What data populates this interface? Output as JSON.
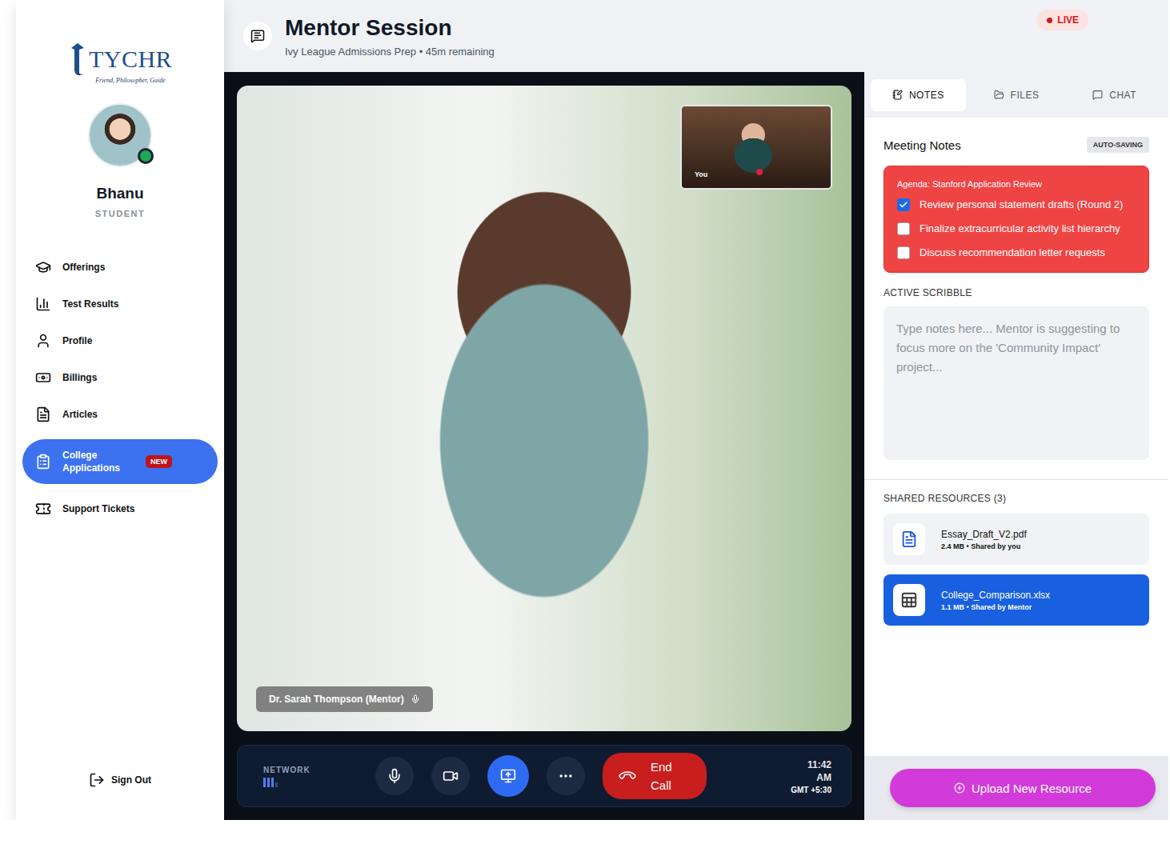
{
  "header": {
    "title": "Mentor Session",
    "subtitle": "Ivy League Admissions Prep • 45m remaining",
    "live_badge": "LIVE"
  },
  "sidebar": {
    "logo": "TYCHR",
    "tagline": "Friend, Philosopher, Guide",
    "user": {
      "name": "Bhanu",
      "role": "STUDENT",
      "online": true
    },
    "items": [
      {
        "label": "Offerings",
        "selected": false,
        "badge": ""
      },
      {
        "label": "Test Results",
        "selected": false,
        "badge": ""
      },
      {
        "label": "Profile",
        "selected": false,
        "badge": ""
      },
      {
        "label": "Billings",
        "selected": false,
        "badge": ""
      },
      {
        "label": "Articles",
        "selected": false,
        "badge": ""
      },
      {
        "label": "College Applications",
        "selected": true,
        "badge": "NEW"
      },
      {
        "label": "Support Tickets",
        "selected": false,
        "badge": ""
      }
    ],
    "sign_out": "Sign Out"
  },
  "video": {
    "mentor_label": "Dr. Sarah Thompson (Mentor)",
    "mentor_mic_on": true,
    "self_label": "You",
    "self_muted": true
  },
  "controls": {
    "network_label": "NETWORK",
    "network_level": 0.75,
    "buttons": [
      {
        "kind": "mic",
        "active": false
      },
      {
        "kind": "camera",
        "active": false
      },
      {
        "kind": "share",
        "active": true
      },
      {
        "kind": "more",
        "active": false
      }
    ],
    "end_call": "End Call",
    "time": "11:42 AM",
    "timezone": "GMT +5:30"
  },
  "panel": {
    "tabs": [
      {
        "label": "NOTES",
        "selected": true
      },
      {
        "label": "FILES",
        "selected": false
      },
      {
        "label": "CHAT",
        "selected": false
      }
    ],
    "notes_title": "Meeting Notes",
    "notes_status": "AUTO-SAVING",
    "agenda": {
      "title": "Agenda: Stanford Application Review",
      "items": [
        {
          "label": "Review personal statement drafts (Round 2)",
          "checked": true
        },
        {
          "label": "Finalize extracurricular activity list hierarchy",
          "checked": false
        },
        {
          "label": "Discuss recommendation letter requests",
          "checked": false
        }
      ]
    },
    "scribble_title": "ACTIVE SCRIBBLE",
    "scribble_placeholder": "Type notes here... Mentor is suggesting to focus more on the 'Community Impact' project...",
    "resources_title": "SHARED RESOURCES (3)",
    "resources": [
      {
        "name": "Essay_Draft_V2.pdf",
        "meta": "2.4 MB • Shared by you",
        "selected": false,
        "kind": "pdf"
      },
      {
        "name": "College_Comparison.xlsx",
        "meta": "1.1 MB • Shared by Mentor",
        "selected": true,
        "kind": "sheet"
      }
    ],
    "upload_button": "Upload New Resource"
  }
}
